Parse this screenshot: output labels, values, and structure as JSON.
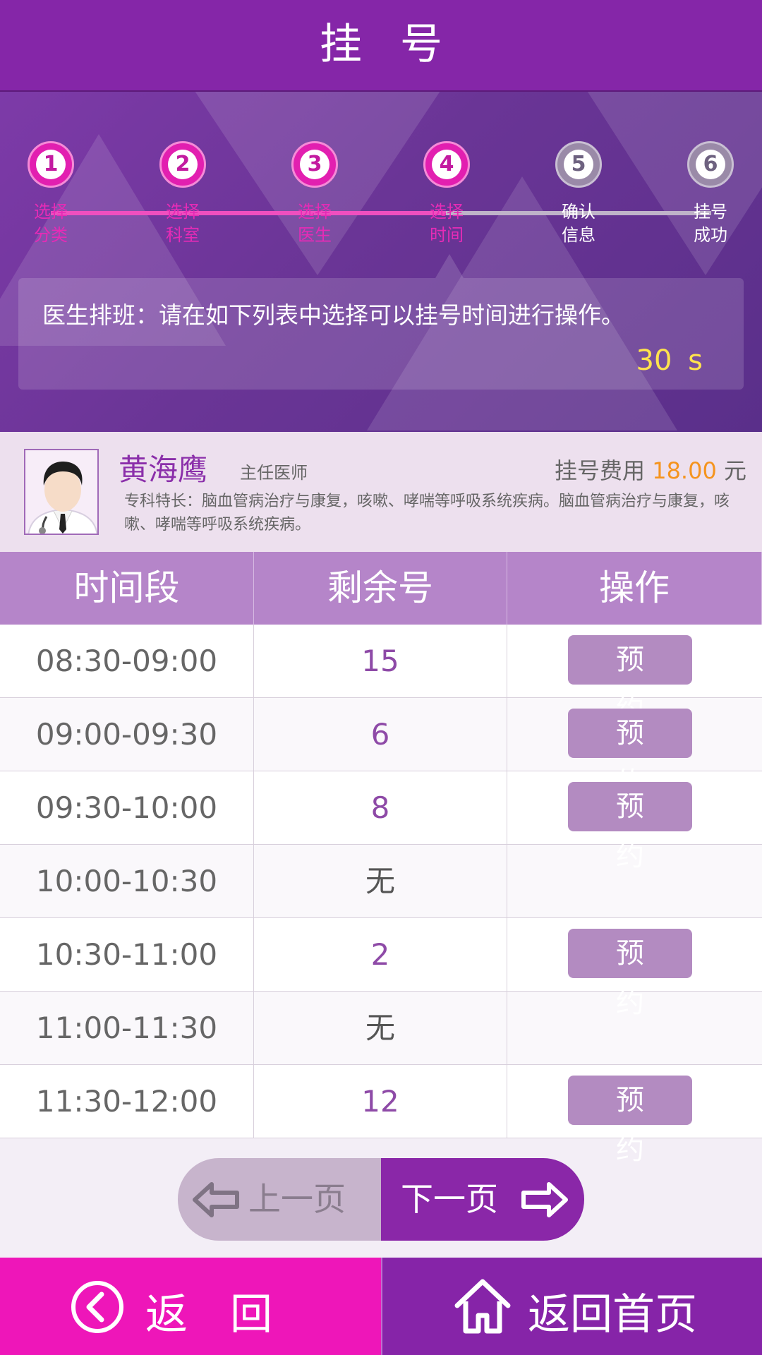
{
  "header": {
    "title": "挂号"
  },
  "steps": [
    {
      "num": "1",
      "line1": "选择",
      "line2": "分类"
    },
    {
      "num": "2",
      "line1": "选择",
      "line2": "科室"
    },
    {
      "num": "3",
      "line1": "选择",
      "line2": "医生"
    },
    {
      "num": "4",
      "line1": "选择",
      "line2": "时间"
    },
    {
      "num": "5",
      "line1": "确认",
      "line2": "信息"
    },
    {
      "num": "6",
      "line1": "挂号",
      "line2": "成功"
    }
  ],
  "steps_completed": 4,
  "notice": {
    "message": "医生排班：请在如下列表中选择可以挂号时间进行操作。",
    "countdown": "30 s"
  },
  "doctor": {
    "name": "黄海鹰",
    "title": "主任医师",
    "fee_label": "挂号费用",
    "fee_amount": "18.00",
    "fee_unit": "元",
    "specialty": "专科特长：脑血管病治疗与康复，咳嗽、哮喘等呼吸系统疾病。脑血管病治疗与康复，咳嗽、哮喘等呼吸系统疾病。"
  },
  "table": {
    "headers": [
      "时间段",
      "剩余号",
      "操作"
    ],
    "book_label": "预 约",
    "rows": [
      {
        "time": "08:30-09:00",
        "remaining": "15",
        "bookable": true
      },
      {
        "time": "09:00-09:30",
        "remaining": "6",
        "bookable": true
      },
      {
        "time": "09:30-10:00",
        "remaining": "8",
        "bookable": true
      },
      {
        "time": "10:00-10:30",
        "remaining": "无",
        "bookable": false
      },
      {
        "time": "10:30-11:00",
        "remaining": "2",
        "bookable": true
      },
      {
        "time": "11:00-11:30",
        "remaining": "无",
        "bookable": false
      },
      {
        "time": "11:30-12:00",
        "remaining": "12",
        "bookable": true
      }
    ]
  },
  "pager": {
    "prev": "上一页",
    "next": "下一页"
  },
  "footer": {
    "back": "返回",
    "home": "返回首页"
  },
  "colors": {
    "header": "#8526a8",
    "step_active": "#e21fb0",
    "fee_amount": "#f5941e",
    "countdown": "#ffe34d",
    "back_button": "#ee16b9",
    "home_button": "#8624a8"
  }
}
